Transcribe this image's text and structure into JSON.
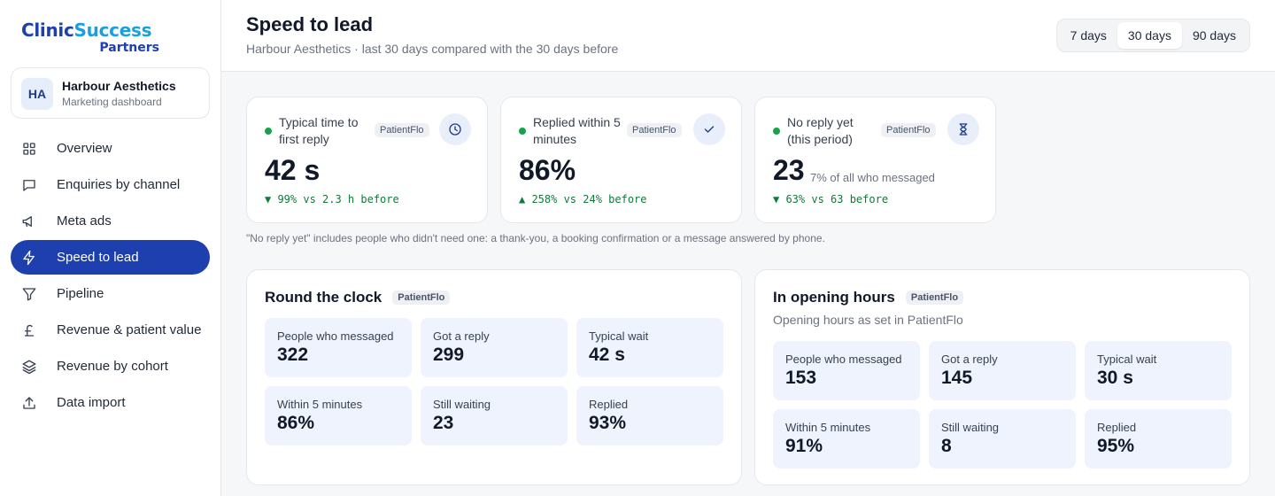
{
  "brand": {
    "line1a": "Clinic",
    "line1b": "Success",
    "line2": "Partners"
  },
  "account": {
    "initials": "HA",
    "name": "Harbour Aesthetics",
    "subtitle": "Marketing dashboard"
  },
  "nav": [
    {
      "label": "Overview",
      "icon": "grid-icon"
    },
    {
      "label": "Enquiries by channel",
      "icon": "chat-icon"
    },
    {
      "label": "Meta ads",
      "icon": "megaphone-icon"
    },
    {
      "label": "Speed to lead",
      "icon": "bolt-icon",
      "active": true
    },
    {
      "label": "Pipeline",
      "icon": "funnel-icon"
    },
    {
      "label": "Revenue & patient value",
      "icon": "pound-icon"
    },
    {
      "label": "Revenue by cohort",
      "icon": "layers-icon"
    },
    {
      "label": "Data import",
      "icon": "upload-icon"
    }
  ],
  "header": {
    "title": "Speed to lead",
    "subtitle": "Harbour Aesthetics · last 30 days compared with the 30 days before",
    "ranges": [
      "7 days",
      "30 days",
      "90 days"
    ],
    "active_range": "30 days"
  },
  "kpis": [
    {
      "label": "Typical time to first reply",
      "badge": "PatientFlo",
      "icon": "clock-icon",
      "value": "42 s",
      "note": "",
      "delta": "▼ 99% vs 2.3 h before"
    },
    {
      "label": "Replied within 5 minutes",
      "badge": "PatientFlo",
      "icon": "check-icon",
      "value": "86%",
      "note": "",
      "delta": "▲ 258% vs 24% before"
    },
    {
      "label": "No reply yet (this period)",
      "badge": "PatientFlo",
      "icon": "hourglass-icon",
      "value": "23",
      "note": "7% of all who messaged",
      "delta": "▼ 63% vs 63 before"
    }
  ],
  "footnote": "\"No reply yet\" includes people who didn't need one: a thank-you, a booking confirmation or a message answered by phone.",
  "panels": {
    "round_clock": {
      "title": "Round the clock",
      "badge": "PatientFlo",
      "tiles": [
        {
          "label": "People who messaged",
          "value": "322"
        },
        {
          "label": "Got a reply",
          "value": "299"
        },
        {
          "label": "Typical wait",
          "value": "42 s"
        },
        {
          "label": "Within 5 minutes",
          "value": "86%"
        },
        {
          "label": "Still waiting",
          "value": "23"
        },
        {
          "label": "Replied",
          "value": "93%"
        }
      ]
    },
    "opening_hours": {
      "title": "In opening hours",
      "badge": "PatientFlo",
      "subtitle": "Opening hours as set in PatientFlo",
      "tiles": [
        {
          "label": "People who messaged",
          "value": "153"
        },
        {
          "label": "Got a reply",
          "value": "145"
        },
        {
          "label": "Typical wait",
          "value": "30 s"
        },
        {
          "label": "Within 5 minutes",
          "value": "91%"
        },
        {
          "label": "Still waiting",
          "value": "8"
        },
        {
          "label": "Replied",
          "value": "95%"
        }
      ]
    }
  },
  "colors": {
    "primary": "#1e40af",
    "accent": "#1aa0e0",
    "success": "#16a34a",
    "tile": "#eef3fd"
  }
}
